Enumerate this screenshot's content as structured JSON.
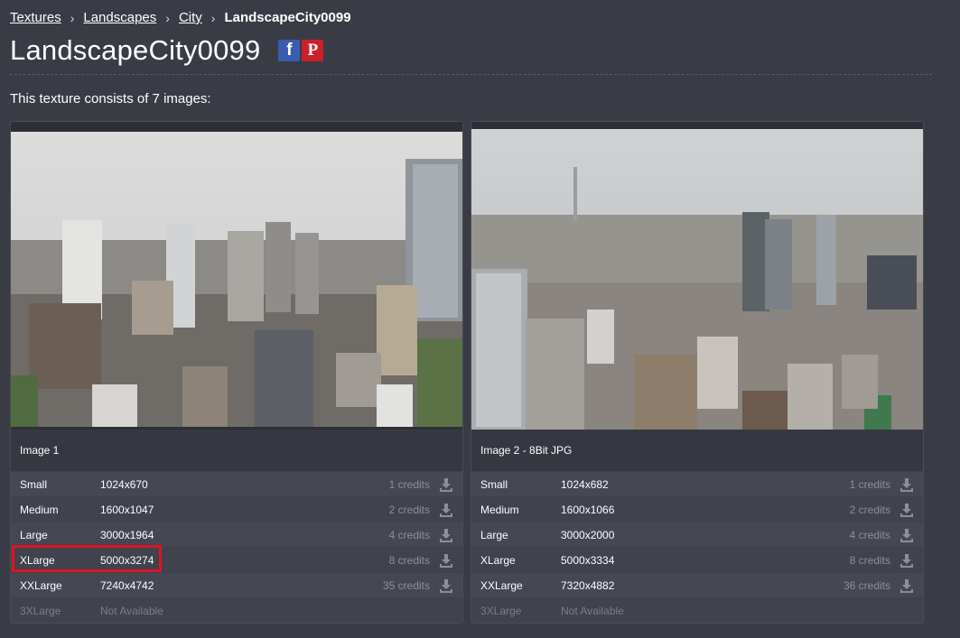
{
  "breadcrumb": {
    "items": [
      "Textures",
      "Landscapes",
      "City"
    ],
    "current": "LandscapeCity0099",
    "separator": "›"
  },
  "page": {
    "title": "LandscapeCity0099",
    "intro": "This texture consists of 7 images:"
  },
  "social": {
    "facebook": "f",
    "pinterest": "P"
  },
  "cards": [
    {
      "label": "Image 1",
      "rows": [
        {
          "size": "Small",
          "dims": "1024x670",
          "credits": "1 credits"
        },
        {
          "size": "Medium",
          "dims": "1600x1047",
          "credits": "2 credits"
        },
        {
          "size": "Large",
          "dims": "3000x1964",
          "credits": "4 credits"
        },
        {
          "size": "XLarge",
          "dims": "5000x3274",
          "credits": "8 credits"
        },
        {
          "size": "XXLarge",
          "dims": "7240x4742",
          "credits": "35 credits"
        },
        {
          "size": "3XLarge",
          "dims": "Not Available",
          "credits": ""
        }
      ]
    },
    {
      "label": "Image 2 - 8Bit JPG",
      "rows": [
        {
          "size": "Small",
          "dims": "1024x682",
          "credits": "1 credits"
        },
        {
          "size": "Medium",
          "dims": "1600x1066",
          "credits": "2 credits"
        },
        {
          "size": "Large",
          "dims": "3000x2000",
          "credits": "4 credits"
        },
        {
          "size": "XLarge",
          "dims": "5000x3334",
          "credits": "8 credits"
        },
        {
          "size": "XXLarge",
          "dims": "7320x4882",
          "credits": "36 credits"
        },
        {
          "size": "3XLarge",
          "dims": "Not Available",
          "credits": ""
        }
      ]
    }
  ],
  "colors": {
    "background": "#3a3c45",
    "highlight": "#e0141e",
    "facebook": "#3b5cb0",
    "pinterest": "#cb2027"
  }
}
